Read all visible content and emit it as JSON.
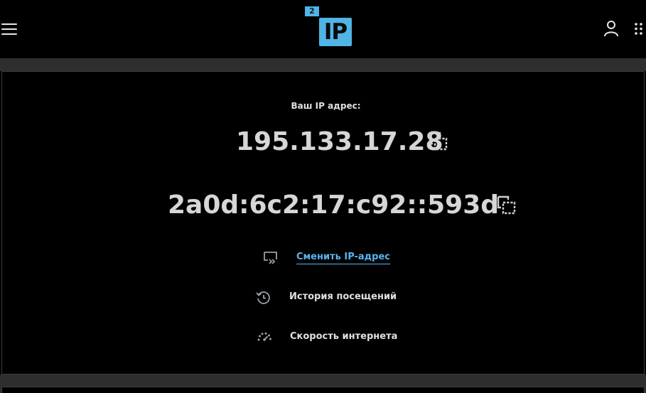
{
  "header": {
    "logo_badge": "2",
    "logo_text": "IP",
    "brand_color": "#50b4e6",
    "icons": {
      "menu": "hamburger-menu-icon",
      "user": "user-icon",
      "apps": "apps-grid-icon"
    }
  },
  "main": {
    "caption": "Ваш IP адрес:",
    "ipv4": "195.133.17.28",
    "ipv6": "2a0d:6c2:17:c92::593d",
    "copy_icon": "copy-icon",
    "actions": [
      {
        "label": "Сменить IP-адрес",
        "icon": "change-ip-icon",
        "link": true,
        "color": "#5ab4f0"
      },
      {
        "label": "История посещений",
        "icon": "history-icon",
        "link": false
      },
      {
        "label": "Скорость интернета",
        "icon": "speedometer-icon",
        "link": false
      }
    ]
  }
}
